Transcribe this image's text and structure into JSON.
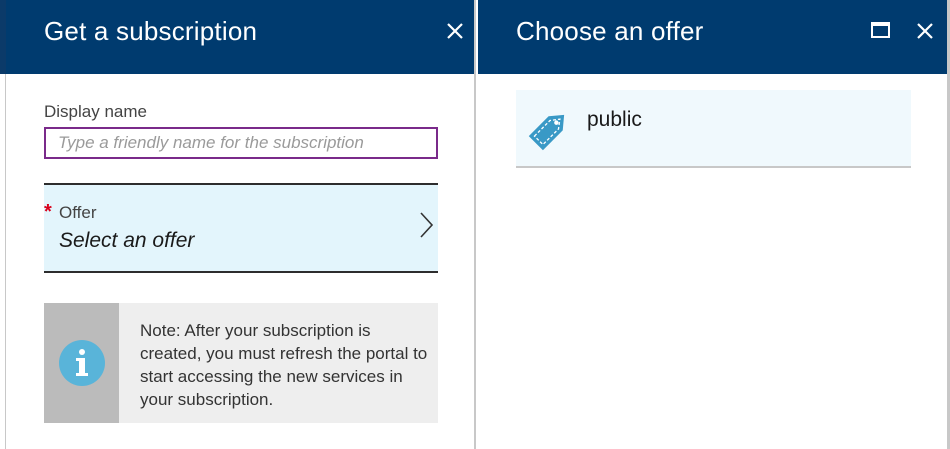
{
  "left_blade": {
    "title": "Get a subscription",
    "display_name_label": "Display name",
    "display_name_placeholder": "Type a friendly name for the subscription",
    "display_name_value": "",
    "offer": {
      "required_marker": "*",
      "label": "Offer",
      "value": "Select an offer"
    },
    "note_text": "Note: After your subscription is created, you must refresh the portal to start accessing the new services in your subscription."
  },
  "right_blade": {
    "title": "Choose an offer",
    "offers": [
      {
        "label": "public",
        "icon": "tag-icon"
      }
    ]
  },
  "colors": {
    "header_bg": "#003b6f",
    "input_focus_border": "#7a2a8a",
    "offer_row_bg": "#e3f5fc",
    "required_star": "#d9001b",
    "info_icon": "#59b4d9",
    "tag_icon": "#3999c6"
  }
}
